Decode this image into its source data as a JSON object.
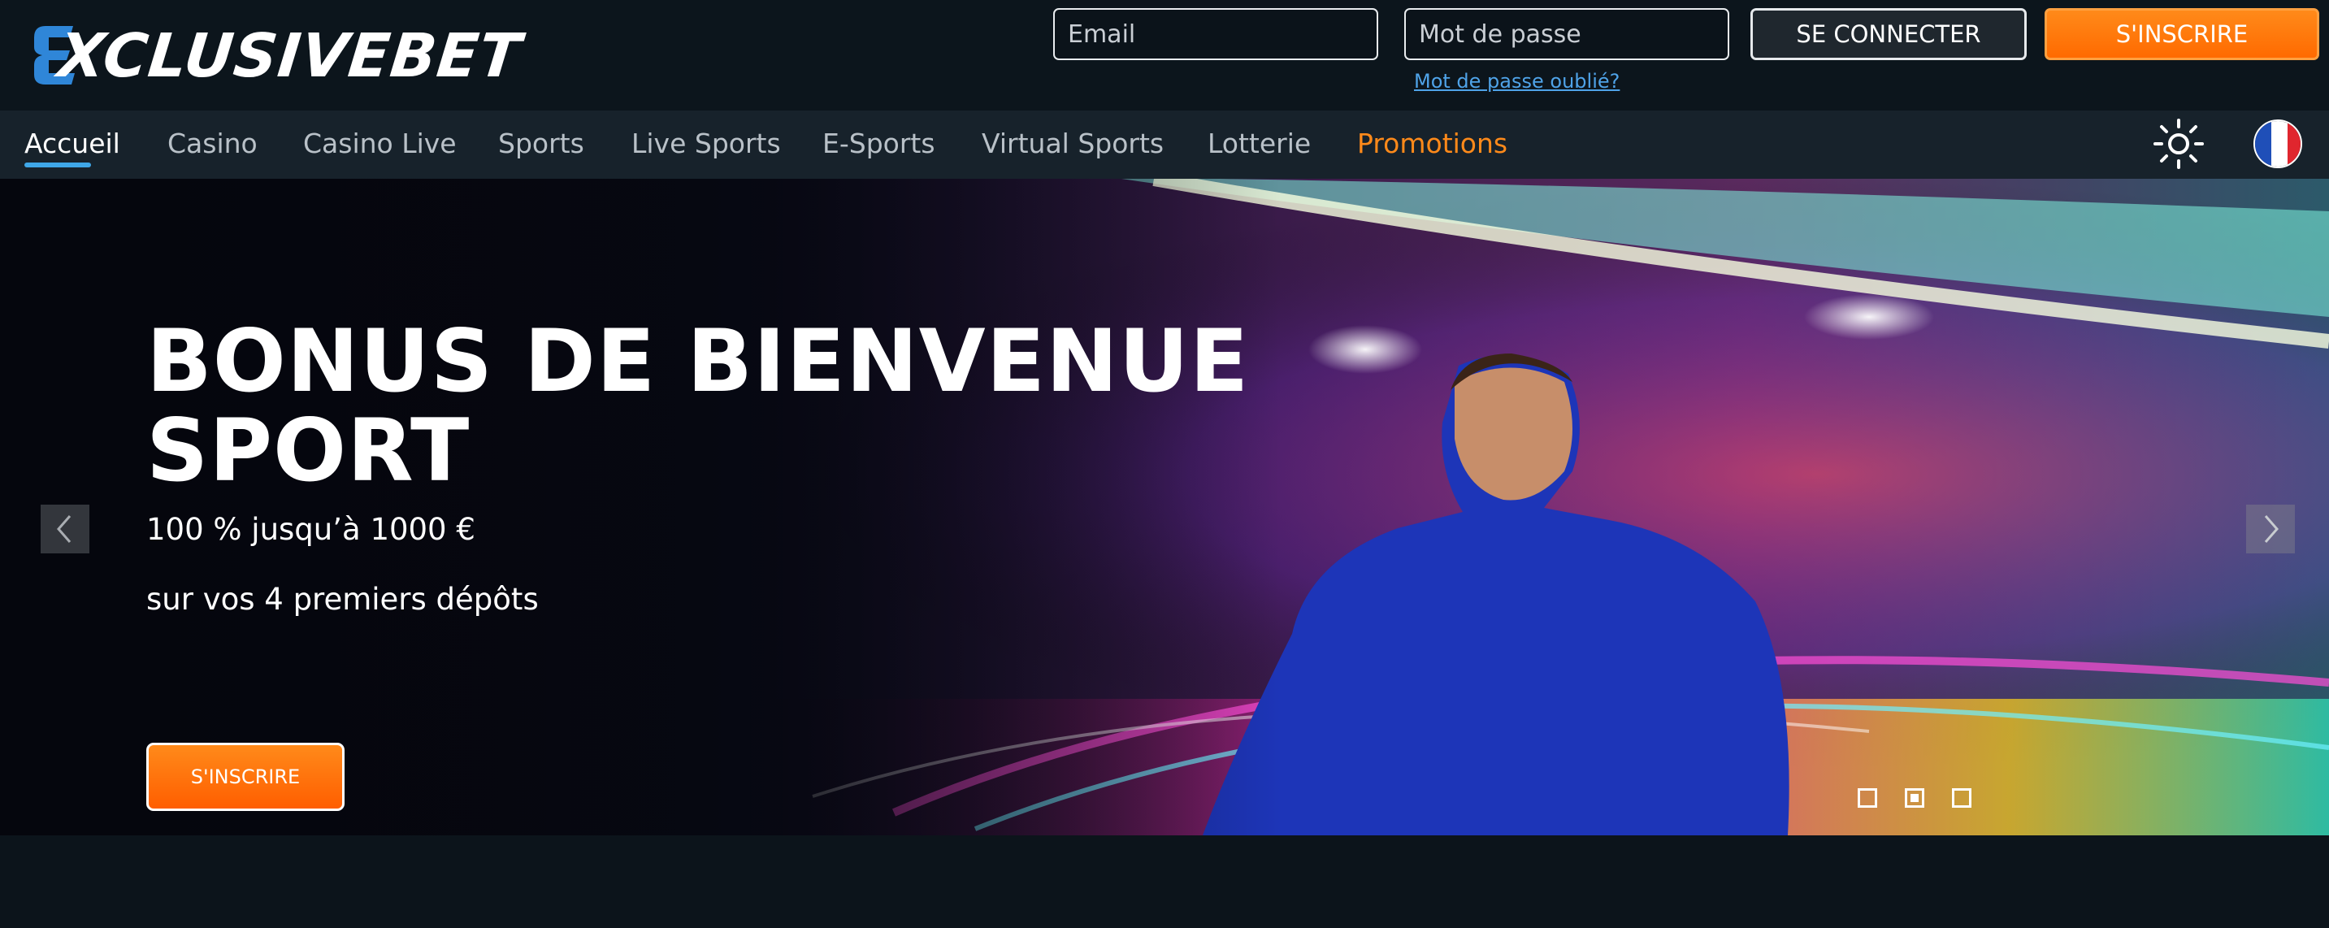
{
  "header": {
    "logo_text": "XCLUSIVEBET",
    "email_placeholder": "Email",
    "password_placeholder": "Mot de passe",
    "login_label": "SE CONNECTER",
    "signup_label": "S'INSCRIRE",
    "forgot_label": "Mot de passe oublié?"
  },
  "nav": {
    "items": [
      {
        "label": "Accueil"
      },
      {
        "label": "Casino"
      },
      {
        "label": "Casino Live"
      },
      {
        "label": "Sports"
      },
      {
        "label": "Live Sports"
      },
      {
        "label": "E-Sports"
      },
      {
        "label": "Virtual Sports"
      },
      {
        "label": "Lotterie"
      },
      {
        "label": "Promotions"
      }
    ],
    "theme_icon": "sun-icon",
    "language_icon": "france-flag-icon"
  },
  "hero": {
    "title_line1": "BONUS DE BIENVENUE",
    "title_line2": "SPORT",
    "subtitle1": "100 % jusqu’à 1000 €",
    "subtitle2": "sur vos 4 premiers dépôts",
    "cta_label": "S'INSCRIRE",
    "slides_total": 3,
    "active_slide": 2
  },
  "colors": {
    "accent_orange": "#ff7a10",
    "accent_blue": "#3fa7e8",
    "background": "#0c141b",
    "nav_background": "#17222b"
  }
}
